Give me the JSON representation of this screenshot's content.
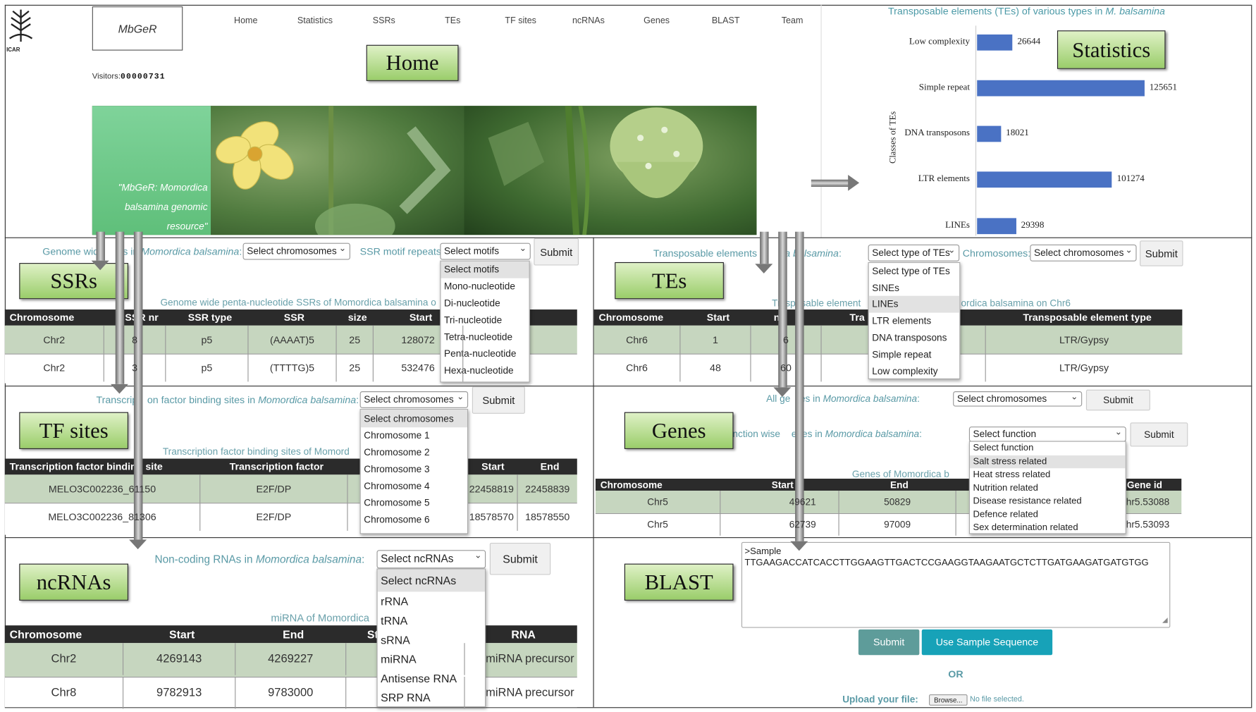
{
  "site": {
    "name": "MbGeR",
    "logo_text": "ICAR",
    "visitors_label": "Visitors:",
    "visitors_count": "00000731",
    "nav": [
      "Home",
      "Statistics",
      "SSRs",
      "TEs",
      "TF sites",
      "ncRNAs",
      "Genes",
      "BLAST",
      "Team"
    ],
    "quote": "\"MbGeR: Momordica balsamina genomic resource\""
  },
  "section_tags": {
    "home": "Home",
    "statistics": "Statistics",
    "ssrs": "SSRs",
    "tes": "TEs",
    "tf_sites": "TF sites",
    "genes": "Genes",
    "ncrnas": "ncRNAs",
    "blast": "BLAST"
  },
  "chart_data": {
    "type": "bar",
    "orientation": "horizontal",
    "title_prefix": "Transposable elements (TEs) of various types in ",
    "title_species": "M. balsamina",
    "ylabel": "Classes of TEs",
    "categories": [
      "Low complexity",
      "Simple repeat",
      "DNA transposons",
      "LTR elements",
      "LINEs"
    ],
    "values": [
      26644,
      125651,
      18021,
      101274,
      29398
    ],
    "bar_color": "#4a72c4"
  },
  "ssrs": {
    "filter_label_a": "Genome wid",
    "filter_label_b": "s in ",
    "filter_species": "Momordica balsamina",
    "filter_colon": ":",
    "chromosome_select": "Select chromosomes",
    "motif_label": "SSR motif repeats:",
    "motif_select": "Select motifs",
    "submit": "Submit",
    "motif_options": [
      "Select motifs",
      "Mono-nucleotide",
      "Di-nucleotide",
      "Tri-nucleotide",
      "Tetra-nucleotide",
      "Penta-nucleotide",
      "Hexa-nucleotide"
    ],
    "table_caption": "Genome wide penta-nucleotide SSRs of Momordica balsamina o",
    "columns": [
      "Chromosome",
      "SSR nr",
      "SSR type",
      "SSR",
      "size",
      "Start"
    ],
    "rows": [
      [
        "Chr2",
        "8",
        "p5",
        "(AAAAT)5",
        "25",
        "128072"
      ],
      [
        "Chr2",
        "3",
        "p5",
        "(TTTTG)5",
        "25",
        "532476"
      ]
    ]
  },
  "tes": {
    "filter_label_a": "Transposable elements i",
    "filter_species": "ca balsamina",
    "filter_colon": ":",
    "type_select": "Select type of TEs",
    "chromosomes_label": "Chromosomes:",
    "chromosome_select": "Select chromosomes",
    "submit": "Submit",
    "type_options": [
      "Select type of TEs",
      "SINEs",
      "LINEs",
      "LTR elements",
      "DNA transposons",
      "Simple repeat",
      "Low complexity"
    ],
    "table_caption_a": "Tr",
    "table_caption_b": "sposable element",
    "table_caption_c": "ordica balsamina on Chr6",
    "columns": [
      "Chromosome",
      "Start",
      "nd",
      "Tra",
      "Transposable element type"
    ],
    "rows": [
      [
        "Chr6",
        "1",
        "6",
        "",
        "LTR/Gypsy"
      ],
      [
        "Chr6",
        "48",
        "60",
        "",
        "LTR/Gypsy"
      ]
    ]
  },
  "tf": {
    "filter_label_a": "Transcrip",
    "filter_label_b": "on factor binding sites in ",
    "filter_species": "Momordica balsamina",
    "filter_colon": ":",
    "chromosome_select": "Select chromosomes",
    "submit": "Submit",
    "chromosome_options": [
      "Select chromosomes",
      "Chromosome 1",
      "Chromosome 2",
      "Chromosome 3",
      "Chromosome 4",
      "Chromosome 5",
      "Chromosome 6"
    ],
    "table_caption": "Transcription factor binding sites of Momord",
    "columns": [
      "Transcription factor binding site",
      "Transcription factor",
      "Start",
      "End"
    ],
    "rows": [
      [
        "MELO3C002236_61150",
        "E2F/DP",
        "22458819",
        "22458839"
      ],
      [
        "MELO3C002236_81306",
        "E2F/DP",
        "18578570",
        "18578550"
      ]
    ]
  },
  "genes": {
    "filter_label_a": "All ge",
    "filter_label_b": "es in ",
    "filter_species": "Momordica balsamina",
    "filter_colon": ":",
    "chromosome_select": "Select chromosomes",
    "submit": "Submit",
    "function_label_a": "nction wise",
    "function_label_b": "enes in ",
    "function_species": "Momordica balsamina",
    "function_colon": ":",
    "function_select": "Select function",
    "submit2": "Submit",
    "function_options": [
      "Select function",
      "Salt stress related",
      "Heat stress related",
      "Nutrition related",
      "Disease resistance related",
      "Defence related",
      "Sex determination related"
    ],
    "table_caption": "Genes of Momordica b",
    "columns": [
      "Chromosome",
      "Start",
      "End",
      "Gene id"
    ],
    "rows": [
      [
        "Chr5",
        "49621",
        "50829",
        "hr5.53088"
      ],
      [
        "Chr5",
        "62739",
        "97009",
        "hr5.53093"
      ]
    ]
  },
  "ncrnas": {
    "filter_label_a": "Non-coding RNAs in ",
    "filter_species": "Momordica balsamina",
    "filter_colon": ":",
    "select": "Select ncRNAs",
    "submit": "Submit",
    "options": [
      "Select ncRNAs",
      "rRNA",
      "tRNA",
      "sRNA",
      "miRNA",
      "Antisense RNA",
      "SRP RNA"
    ],
    "table_caption": "miRNA of Momordica",
    "columns": [
      "Chromosome",
      "Start",
      "End",
      "St",
      "RNA"
    ],
    "rows": [
      [
        "Chr2",
        "4269143",
        "4269227",
        "",
        "miRNA precursor"
      ],
      [
        "Chr8",
        "9782913",
        "9783000",
        "",
        "miRNA precursor"
      ]
    ]
  },
  "blast": {
    "sequence_header": ">Sample",
    "sequence": "TTGAAGACCATCACCTTGGAAGTTGACTCCGAAGGTAAGAATGCTCTTGATGAAGATGATGTGG",
    "submit": "Submit",
    "sample_button": "Use Sample Sequence",
    "or": "OR",
    "upload_label": "Upload your file:",
    "browse": "Browse...",
    "no_file": "No file selected."
  }
}
